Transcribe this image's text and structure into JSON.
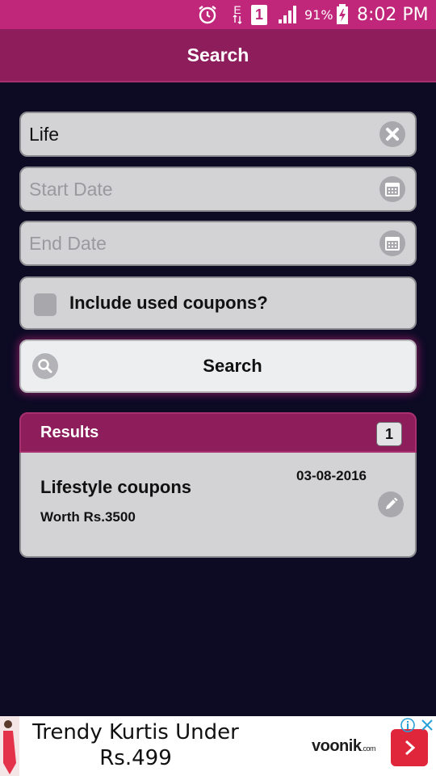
{
  "status_bar": {
    "network_type": "E",
    "sim_slot": "1",
    "battery_percent": "91%",
    "time": "8:02 PM",
    "icons": [
      "alarm-icon",
      "data-arrows-icon",
      "sim-icon",
      "signal-icon",
      "battery-charging-icon"
    ]
  },
  "header": {
    "title": "Search"
  },
  "search_form": {
    "query_value": "Life",
    "start_date_placeholder": "Start Date",
    "end_date_placeholder": "End Date",
    "include_used_label": "Include used coupons?",
    "include_used_checked": false,
    "search_button_label": "Search"
  },
  "results": {
    "title": "Results",
    "count": "1",
    "items": [
      {
        "title": "Lifestyle coupons",
        "worth": "Worth Rs.3500",
        "date": "03-08-2016"
      }
    ]
  },
  "ad": {
    "text": "Trendy Kurtis Under Rs.499",
    "brand": "voonik",
    "brand_suffix": ".com"
  },
  "colors": {
    "status_bar": "#c0267a",
    "header": "#8e1d5c",
    "background": "#0d0a24",
    "field": "#d3d3d5",
    "ad_arrow": "#e0263a"
  }
}
